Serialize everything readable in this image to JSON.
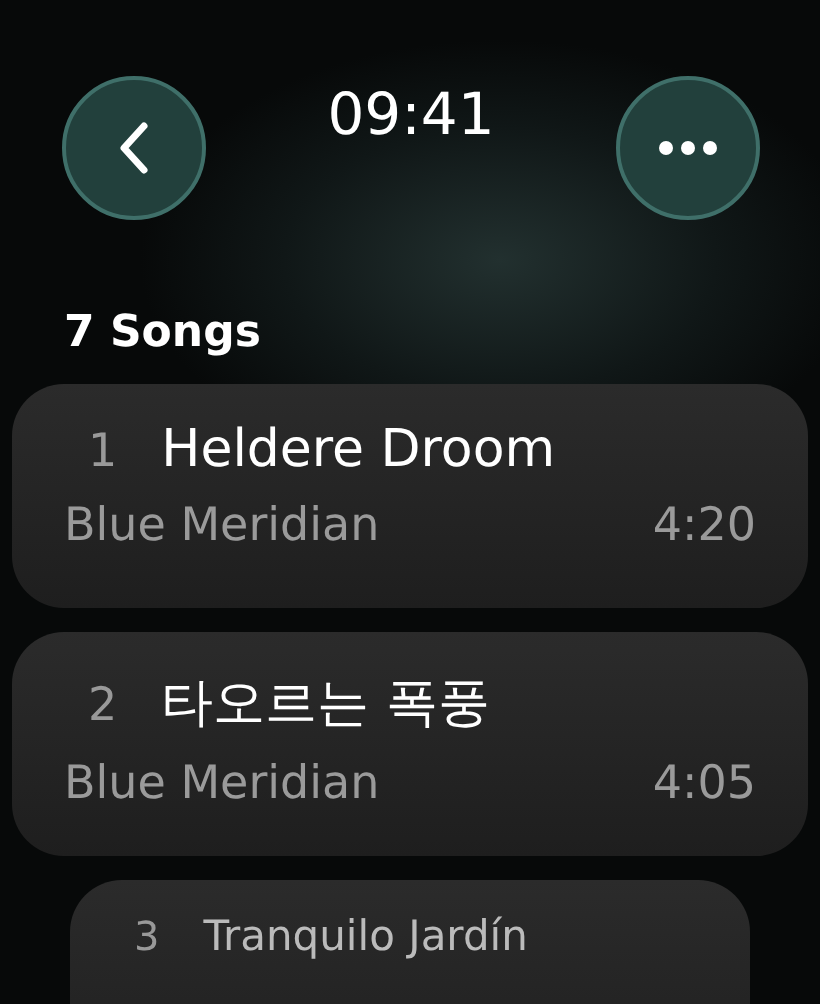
{
  "header": {
    "time": "09:41"
  },
  "section_title": "7 Songs",
  "songs": [
    {
      "number": "1",
      "title": "Heldere Droom",
      "artist": "Blue Meridian",
      "duration": "4:20",
      "dimmed": false
    },
    {
      "number": "2",
      "title": "타오르는 폭풍",
      "artist": "Blue Meridian",
      "duration": "4:05",
      "dimmed": false
    },
    {
      "number": "3",
      "title": "Tranquilo Jardín",
      "dimmed": true
    }
  ]
}
